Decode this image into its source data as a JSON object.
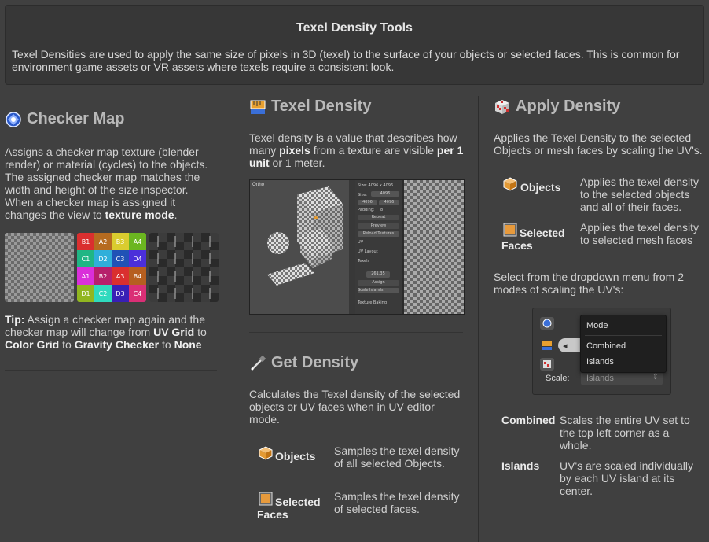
{
  "header": {
    "title": "Texel Density Tools",
    "description": "Texel Densities are used to apply the same size of pixels in 3D (texel) to the surface of your objects or selected faces. This is common for environment game assets or VR assets where texels require a consistent look."
  },
  "checker_map": {
    "title": "Checker Map",
    "description_parts": {
      "a": "Assigns a checker map texture (blender render) or material (cycles) to the objects. The assigned checker map matches the width and height of the size inspector. When a checker map is assigned it changes the view to ",
      "b": "texture mode",
      "c": "."
    },
    "color_grid_labels": [
      "B1",
      "A2",
      "B3",
      "A4",
      "C1",
      "D2",
      "C3",
      "D4",
      "A1",
      "B2",
      "A3",
      "B4",
      "D1",
      "C2",
      "D3",
      "C4"
    ],
    "tip": {
      "prefix": "Tip:",
      "text1": " Assign a checker map again and the checker map will change from ",
      "uv_grid": "UV Grid",
      "to1": " to ",
      "color_grid": "Color Grid",
      "to2": " to ",
      "gravity": "Gravity Checker",
      "to3": " to ",
      "none": "None"
    }
  },
  "texel_density": {
    "title": "Texel Density",
    "desc_a": "Texel density is a value that describes how many ",
    "desc_pixels": "pixels",
    "desc_b": " from a texture are visible ",
    "desc_per": "per 1 unit",
    "desc_c": " or 1 meter.",
    "screenshot": {
      "viewport_label": "Ortho",
      "size_label": "Size: 4096 x 4096",
      "size_field": "Size:",
      "size_value": "4096",
      "w_value": "4096",
      "h_value": "4096",
      "padding": "Padding:",
      "padding_value": "8",
      "repeat": "Repeat",
      "preview": "Preview",
      "reload": "Reload Textures",
      "uv": "UV",
      "uv_layout": "UV Layout",
      "texels": "Texels",
      "texel_value": "261.35",
      "assign": "Assign",
      "scale_islands": "Scale Islands",
      "texture_baking": "Texture Baking"
    }
  },
  "get_density": {
    "title": "Get Density",
    "description": "Calculates the Texel density of the selected objects or UV faces when in UV editor mode.",
    "rows": [
      {
        "label": "Objects",
        "desc": "Samples the texel density of all selected Objects."
      },
      {
        "label": "Selected Faces",
        "desc": "Samples the texel density of selected faces."
      }
    ]
  },
  "apply_density": {
    "title": "Apply Density",
    "description": "Applies the Texel Density to the selected Objects or mesh faces by scaling the UV's.",
    "rows": [
      {
        "label": "Objects",
        "desc": "Applies the texel density to the selected objects and all of their faces."
      },
      {
        "label": "Selected Faces",
        "desc": "Applies the texel density to selected mesh faces"
      }
    ],
    "dropdown_intro": "Select from the dropdown menu from 2 modes of scaling the UV's:",
    "dropdown": {
      "header": "Mode",
      "options": [
        "Combined",
        "Islands"
      ],
      "scale_label": "Scale:",
      "scale_value": "Islands"
    },
    "modes": [
      {
        "label": "Combined",
        "desc": "Scales the entire UV set to the top left corner as a whole."
      },
      {
        "label": "Islands",
        "desc": "UV's are scaled individually by each UV island at its center."
      }
    ]
  },
  "colors": {
    "background": "#404040",
    "header_bg": "#373737",
    "title_gray": "#b9b9b9",
    "text": "#d2d2d2"
  }
}
